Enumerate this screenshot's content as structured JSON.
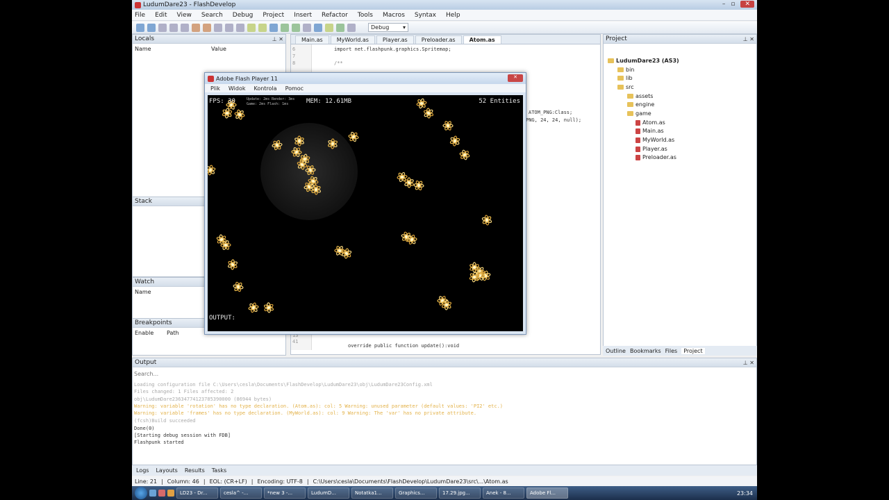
{
  "window": {
    "title": "LudumDare23 - FlashDevelop"
  },
  "menu": [
    "File",
    "Edit",
    "View",
    "Search",
    "Debug",
    "Project",
    "Insert",
    "Refactor",
    "Tools",
    "Macros",
    "Syntax",
    "Help"
  ],
  "toolbar": {
    "config": "Debug"
  },
  "locals": {
    "title": "Locals",
    "col_name": "Name",
    "col_value": "Value"
  },
  "stack": {
    "title": "Stack"
  },
  "watch": {
    "title": "Watch",
    "col_name": "Name"
  },
  "breakpoints": {
    "title": "Breakpoints",
    "col_enable": "Enable",
    "col_path": "Path"
  },
  "editor": {
    "tabs": [
      "Main.as",
      "MyWorld.as",
      "Player.as",
      "Preloader.as",
      "Atom.as"
    ],
    "code_top": "import net.flashpunk.graphics.Spritemap;",
    "code_doc": "/**",
    "code_right1": "ATOM_PNG:Class;",
    "code_right2": "PNG, 24, 24, null);",
    "code_bottom": "override public function update():void",
    "ln6": "6",
    "ln7": "7",
    "ln8": "8",
    "ln13": "13",
    "ln41": "41"
  },
  "project": {
    "title": "Project",
    "root": "LudumDare23 (AS3)",
    "items": [
      "bin",
      "lib",
      "src",
      "assets",
      "engine",
      "game",
      "Atom.as",
      "Main.as",
      "MyWorld.as",
      "Player.as",
      "Preloader.as"
    ],
    "bottom_tabs": [
      "Outline",
      "Bookmarks",
      "Files",
      "Project"
    ]
  },
  "flash": {
    "title": "Adobe Flash Player 11",
    "menu": [
      "Plik",
      "Widok",
      "Kontrola",
      "Pomoc"
    ],
    "fps": "FPS: 30",
    "stats1": "Update: 2ms  Render: 3ms",
    "stats2": "Game: 2ms  Flash: 1ms",
    "mem": "MEM: 12.61MB",
    "entities": "52 Entities",
    "output": "OUTPUT:"
  },
  "output": {
    "title": "Output",
    "search_placeholder": "Search...",
    "lines": [
      "Loading configuration file C:\\Users\\cesla\\Documents\\FlashDevelop\\LudumDare23\\obj\\LudumDare23Config.xml",
      "Files changed: 1 Files affected: 2",
      "obj\\LudumDare23634774123785390000 (86944 bytes)",
      "  Warning: variable 'rotation' has no type declaration. (Atom.as): col: 5  Warning: unused parameter (default values: 'PI2' etc.)",
      "  Warning: variable 'frames' has no type declaration. (MyWorld.as): col: 9  Warning: The 'var' has no private attribute.",
      "(fcsh)Build succeeded",
      "Done(0)",
      "[Starting debug session with FDB]",
      "Flashpunk started"
    ],
    "bottom_tabs": [
      "Logs",
      "Layouts",
      "Results",
      "Tasks"
    ]
  },
  "status": {
    "line": "Line: 21",
    "column": "Column: 46",
    "eol": "EOL: (CR+LF)",
    "encoding": "Encoding: UTF-8",
    "path": "C:\\Users\\cesla\\Documents\\FlashDevelop\\LudumDare23\\src\\...\\Atom.as"
  },
  "taskbar": {
    "items": [
      "LD23 - Dr...",
      "cesla^ -...",
      "*new 3 -...",
      "LudumD...",
      "Notatka1...",
      "Graphics...",
      "17.29.jpg...",
      "Anek - 8...",
      "Adobe Fl..."
    ],
    "clock": "23:34"
  }
}
